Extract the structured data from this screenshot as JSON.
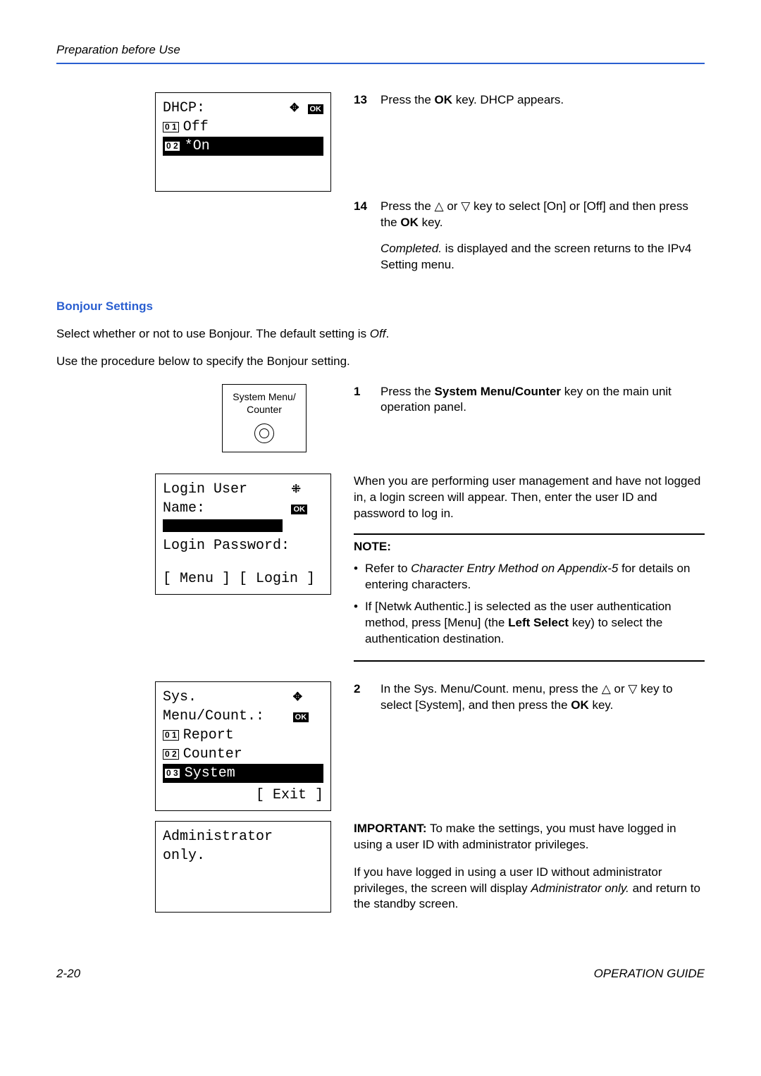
{
  "header": "Preparation before Use",
  "dhcp": {
    "title": "DHCP:",
    "opt1_num": "0 1",
    "opt1": "Off",
    "opt2_num": "0 2",
    "opt2": "*On",
    "ok": "OK"
  },
  "step13": {
    "n": "13",
    "pre": "Press the ",
    "bold": "OK",
    "post": " key. DHCP appears."
  },
  "step14": {
    "n": "14",
    "l1_pre": "Press the ",
    "l1_mid": " or ",
    "l1_post": " key to select [On] or [Off] and then press the ",
    "l1_bold": "OK",
    "l1_end": " key.",
    "l2_italic": "Completed.",
    "l2_rest": " is displayed and the screen returns to the IPv4 Setting menu."
  },
  "section": "Bonjour Settings",
  "bonjourLine1_pre": "Select whether or not to use Bonjour. The default setting is ",
  "bonjourLine1_italic": "Off",
  "bonjourLine1_post": ".",
  "bonjourLine2": "Use the procedure below to specify the Bonjour setting.",
  "panel": {
    "l1": "System Menu/",
    "l2": "Counter"
  },
  "step1": {
    "n": "1",
    "pre": "Press the ",
    "bold": "System Menu/Counter",
    "post": " key on the main unit operation panel."
  },
  "login_screen": {
    "title": "Login User Name:",
    "pw": "Login Password:",
    "menu": "[ Menu  ] [ Login  ]",
    "ok": "OK"
  },
  "login_desc": "When you are performing user management and have not logged in, a login screen will appear. Then, enter the user ID and password to log in.",
  "note_head": "NOTE:",
  "note_b1_pre": "Refer to ",
  "note_b1_italic": "Character Entry Method on Appendix-5",
  "note_b1_post": " for details on entering characters.",
  "note_b2_pre": "If [Netwk Authentic.] is selected as the user authentication method, press [Menu] (the ",
  "note_b2_bold1": "Left Select",
  "note_b2_mid": " key) to select the authentication destination.",
  "sysmenu": {
    "title": "Sys. Menu/Count.:",
    "i1n": "0 1",
    "i1": "Report",
    "i2n": "0 2",
    "i2": "Counter",
    "i3n": "0 3",
    "i3": "System",
    "exit": "[  Exit   ]",
    "ok": "OK"
  },
  "step2": {
    "n": "2",
    "pre": "In the Sys. Menu/Count. menu, press the ",
    "mid": " or ",
    "post": " key to select [System], and then press the ",
    "bold": "OK",
    "end": " key."
  },
  "admin_screen": "Administrator only.",
  "important_bold": "IMPORTANT:",
  "important_rest": " To make the settings, you must have logged in using a user ID with administrator privileges.",
  "admin_p2_pre": "If you have logged in using a user ID without administrator privileges, the screen will display ",
  "admin_p2_italic": "Administrator only.",
  "admin_p2_post": " and return to the standby screen.",
  "footer_left": "2-20",
  "footer_right": "OPERATION GUIDE"
}
